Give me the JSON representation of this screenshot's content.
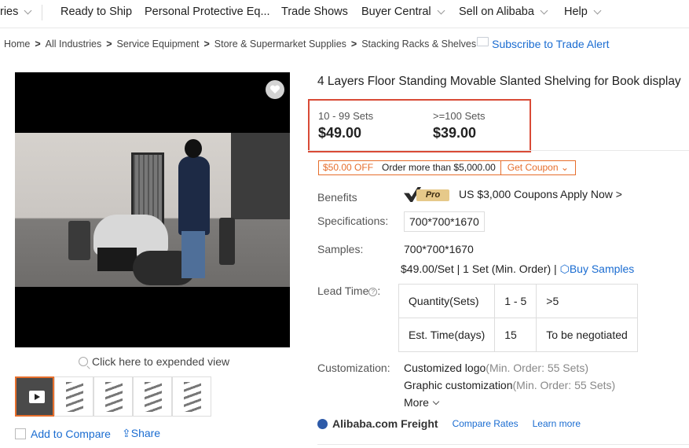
{
  "nav": {
    "items": [
      {
        "label": "ries",
        "dropdown": true
      },
      {
        "label": "Ready to Ship",
        "dropdown": false
      },
      {
        "label": "Personal Protective Eq...",
        "dropdown": false
      },
      {
        "label": "Trade Shows",
        "dropdown": false
      },
      {
        "label": "Buyer Central",
        "dropdown": true
      },
      {
        "label": "Sell on Alibaba",
        "dropdown": true
      },
      {
        "label": "Help",
        "dropdown": true
      }
    ]
  },
  "breadcrumb": {
    "items": [
      "Home",
      "All Industries",
      "Service Equipment",
      "Store & Supermarket Supplies",
      "Stacking Racks & Shelves"
    ],
    "subscribe": "Subscribe to Trade Alert"
  },
  "media": {
    "expand_label": "Click here to expended view",
    "thumbnails": 5,
    "add_compare": "Add to Compare",
    "share": "Share"
  },
  "product": {
    "title": "4 Layers Floor Standing Movable Slanted Shelving for Book display",
    "prices": [
      {
        "qty": "10 - 99 Sets",
        "price": "$49.00"
      },
      {
        "qty": ">=100 Sets",
        "price": "$39.00"
      }
    ],
    "coupon": {
      "off": "$50.00 OFF",
      "condition": "Order more than $5,000.00",
      "get": "Get Coupon"
    },
    "benefits": {
      "label": "Benefits",
      "badge": "Pro",
      "text": "US $3,000 Coupons",
      "apply": "Apply Now >"
    },
    "specifications": {
      "label": "Specifications:",
      "value": "700*700*1670"
    },
    "samples": {
      "label": "Samples:",
      "value": "700*700*1670",
      "price_line": "$49.00/Set | 1 Set (Min. Order) |",
      "buy": "Buy Samples"
    },
    "lead_time": {
      "label": "Lead Time",
      "rows": [
        [
          "Quantity(Sets)",
          "1 - 5",
          ">5"
        ],
        [
          "Est. Time(days)",
          "15",
          "To be negotiated"
        ]
      ]
    },
    "customization": {
      "label": "Customization:",
      "items": [
        {
          "name": "Customized logo",
          "min": "(Min. Order: 55 Sets)"
        },
        {
          "name": "Graphic customization",
          "min": "(Min. Order: 55 Sets)"
        }
      ],
      "more": "More"
    },
    "freight": {
      "brand": "Alibaba.com Freight",
      "compare": "Compare Rates",
      "learn": "Learn more"
    }
  },
  "colors": {
    "accent": "#e66e2c",
    "link": "#1a6cd1",
    "price_border": "#d94a36"
  }
}
